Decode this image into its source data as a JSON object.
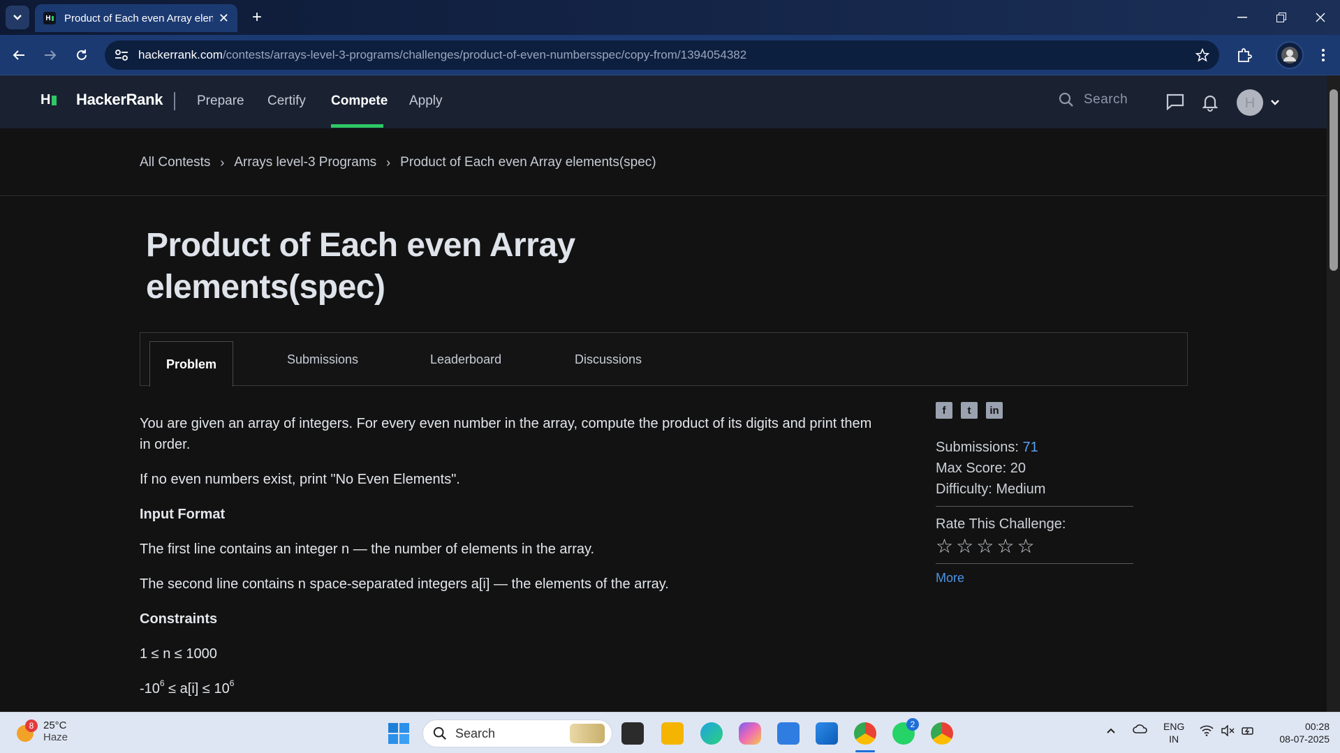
{
  "browser": {
    "tab_title": "Product of Each even Array elen",
    "url_host": "hackerrank.com",
    "url_path": "/contests/arrays-level-3-programs/challenges/product-of-even-numbersspec/copy-from/1394054382"
  },
  "header": {
    "logo_mark": "H",
    "brand": "HackerRank",
    "nav": [
      {
        "label": "Prepare"
      },
      {
        "label": "Certify"
      },
      {
        "label": "Compete"
      },
      {
        "label": "Apply"
      }
    ],
    "search_placeholder": "Search",
    "accent": "#2ec866"
  },
  "breadcrumb": [
    {
      "label": "All Contests"
    },
    {
      "label": "Arrays level-3 Programs"
    },
    {
      "label": "Product of Each even Array elements(spec)"
    }
  ],
  "challenge": {
    "title_line1": "Product of Each even Array",
    "title_line2": "elements(spec)",
    "tabs": [
      {
        "label": "Problem"
      },
      {
        "label": "Submissions"
      },
      {
        "label": "Leaderboard"
      },
      {
        "label": "Discussions"
      }
    ],
    "description": "You are given an array of integers. For every even number in the array, compute the product of its digits and print them in order.",
    "no_even": "If no even numbers exist, print \"No Even Elements\".",
    "input_format_heading": "Input Format",
    "input_line1": "The first line contains an integer n — the number of elements in the array.",
    "input_line2": "The second line contains n space-separated integers a[i] — the elements of the array.",
    "constraints_heading": "Constraints",
    "constraint1": "1 ≤ n ≤ 1000",
    "constraint2_pre": "-10",
    "constraint2_exp": "6",
    "constraint2_mid": " ≤ a[i] ≤ 10",
    "constraint2_exp2": "6"
  },
  "sidebar": {
    "share_icons": [
      "facebook-icon",
      "twitter-icon",
      "linkedin-icon"
    ],
    "submissions_label": "Submissions:",
    "submissions_value": "71",
    "max_score_label": "Max Score:",
    "max_score_value": "20",
    "difficulty_label": "Difficulty:",
    "difficulty_value": "Medium",
    "rate_label": "Rate This Challenge:",
    "rating_stars": 0,
    "more_label": "More"
  },
  "taskbar": {
    "weather_badge": "8",
    "temperature": "25°C",
    "weather": "Haze",
    "search_placeholder": "Search",
    "whatsapp_badge": "2",
    "lang_top": "ENG",
    "lang_bottom": "IN",
    "time": "00:28",
    "date": "08-07-2025"
  }
}
